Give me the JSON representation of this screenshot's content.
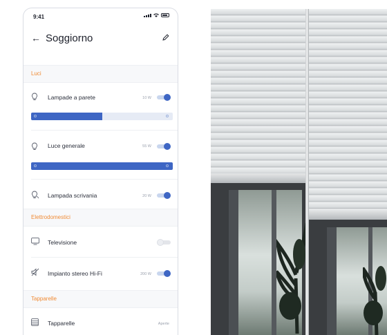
{
  "status": {
    "time": "9:41"
  },
  "header": {
    "title": "Soggiorno"
  },
  "sections": {
    "lights": "Luci",
    "appliances": "Elettrodomestici",
    "shutters": "Tapparelle"
  },
  "rows": {
    "wall_lamps": {
      "label": "Lampade a parete",
      "power": "10 W",
      "on": true,
      "level": 0.5
    },
    "main_light": {
      "label": "Luce generale",
      "power": "55 W",
      "on": true,
      "level": 1.0
    },
    "desk_lamp": {
      "label": "Lampada scrivania",
      "power": "20 W",
      "on": true
    },
    "tv": {
      "label": "Televisione",
      "on": false
    },
    "hifi": {
      "label": "Impianto stereo Hi-Fi",
      "power": "200 W",
      "on": true
    },
    "shutters": {
      "label": "Tapparelle",
      "state": "Aperte"
    }
  },
  "colors": {
    "accent": "#3e66c4",
    "section_label": "#f08b35",
    "track": "#c9d6ee"
  },
  "icons": {
    "back": "arrow-left-icon",
    "edit": "pencil-icon",
    "bulb": "lightbulb-icon",
    "tv": "tv-icon",
    "speaker": "speaker-icon",
    "shutter": "shutter-icon"
  }
}
